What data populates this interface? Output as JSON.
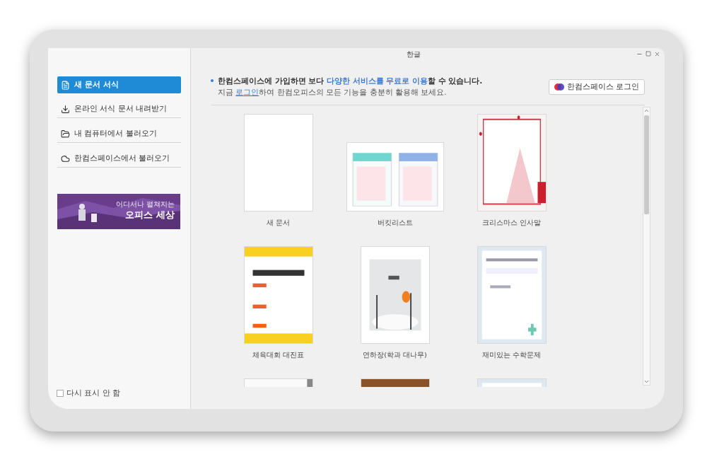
{
  "window": {
    "title": "한글"
  },
  "sidebar": {
    "items": [
      {
        "label": "새 문서 서식",
        "kind": "file",
        "selected": true
      },
      {
        "label": "온라인 서식 문서 내려받기",
        "kind": "download",
        "selected": false
      },
      {
        "label": "내 컴퓨터에서 불러오기",
        "kind": "folder",
        "selected": false
      },
      {
        "label": "한컴스페이스에서 불러오기",
        "kind": "cloud",
        "selected": false
      }
    ],
    "banner": {
      "line1": "어디서나 펼쳐지는",
      "line2": "오피스 세상"
    },
    "dont_show_again": {
      "label": "다시 표시 안 함",
      "checked": false
    }
  },
  "notice": {
    "line1": [
      {
        "kind": "plain",
        "text": "한컴스페이스에 가입하면 보다 "
      },
      {
        "kind": "highlight",
        "text": "다양한 서비스를 무료로 이용"
      },
      {
        "kind": "plain",
        "text": "할 수 있습니다."
      }
    ],
    "line2": [
      {
        "kind": "plain",
        "text": "지금 "
      },
      {
        "kind": "link",
        "text": "로그인"
      },
      {
        "kind": "plain",
        "text": "하여 한컴오피스의 모든 기능을 충분히 활용해 보세요."
      }
    ],
    "login_button": "한컴스페이스 로그인"
  },
  "templates": [
    {
      "kind": "blank",
      "label": "새 문서"
    },
    {
      "kind": "landscape",
      "label": "버킷리스트"
    },
    {
      "kind": "portrait",
      "label": "크리스마스 인사말"
    },
    {
      "kind": "portrait",
      "label": "체육대회 대진표"
    },
    {
      "kind": "portrait",
      "label": "연하장(학과 대나무)"
    },
    {
      "kind": "portrait",
      "label": "재미있는 수학문제"
    },
    {
      "kind": "portrait"
    },
    {
      "kind": "portrait"
    },
    {
      "kind": "portrait"
    }
  ]
}
